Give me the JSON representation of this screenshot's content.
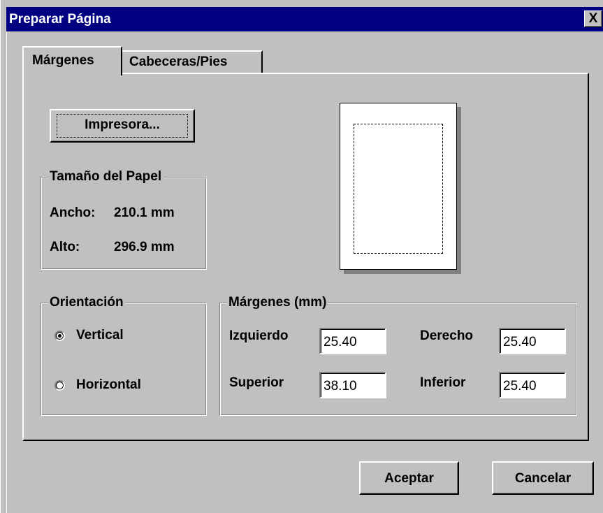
{
  "window": {
    "title": "Preparar Página",
    "close_label": "X"
  },
  "tabs": [
    {
      "label": "Márgenes"
    },
    {
      "label": "Cabeceras/Pies"
    }
  ],
  "printer_button": "Impresora...",
  "paper_size": {
    "legend": "Tamaño del Papel",
    "width_label": "Ancho:",
    "width_value": "210.1 mm",
    "height_label": "Alto:",
    "height_value": "296.9 mm"
  },
  "orientation": {
    "legend": "Orientación",
    "options": [
      {
        "label": "Vertical",
        "selected": true
      },
      {
        "label": "Horizontal",
        "selected": false
      }
    ]
  },
  "margins": {
    "legend": "Márgenes (mm)",
    "left_label": "Izquierdo",
    "left_value": "25.40",
    "right_label": "Derecho",
    "right_value": "25.40",
    "top_label": "Superior",
    "top_value": "38.10",
    "bottom_label": "Inferior",
    "bottom_value": "25.40"
  },
  "buttons": {
    "ok": "Aceptar",
    "cancel": "Cancelar"
  },
  "colors": {
    "titlebar": "#000080",
    "face": "#c0c0c0"
  }
}
